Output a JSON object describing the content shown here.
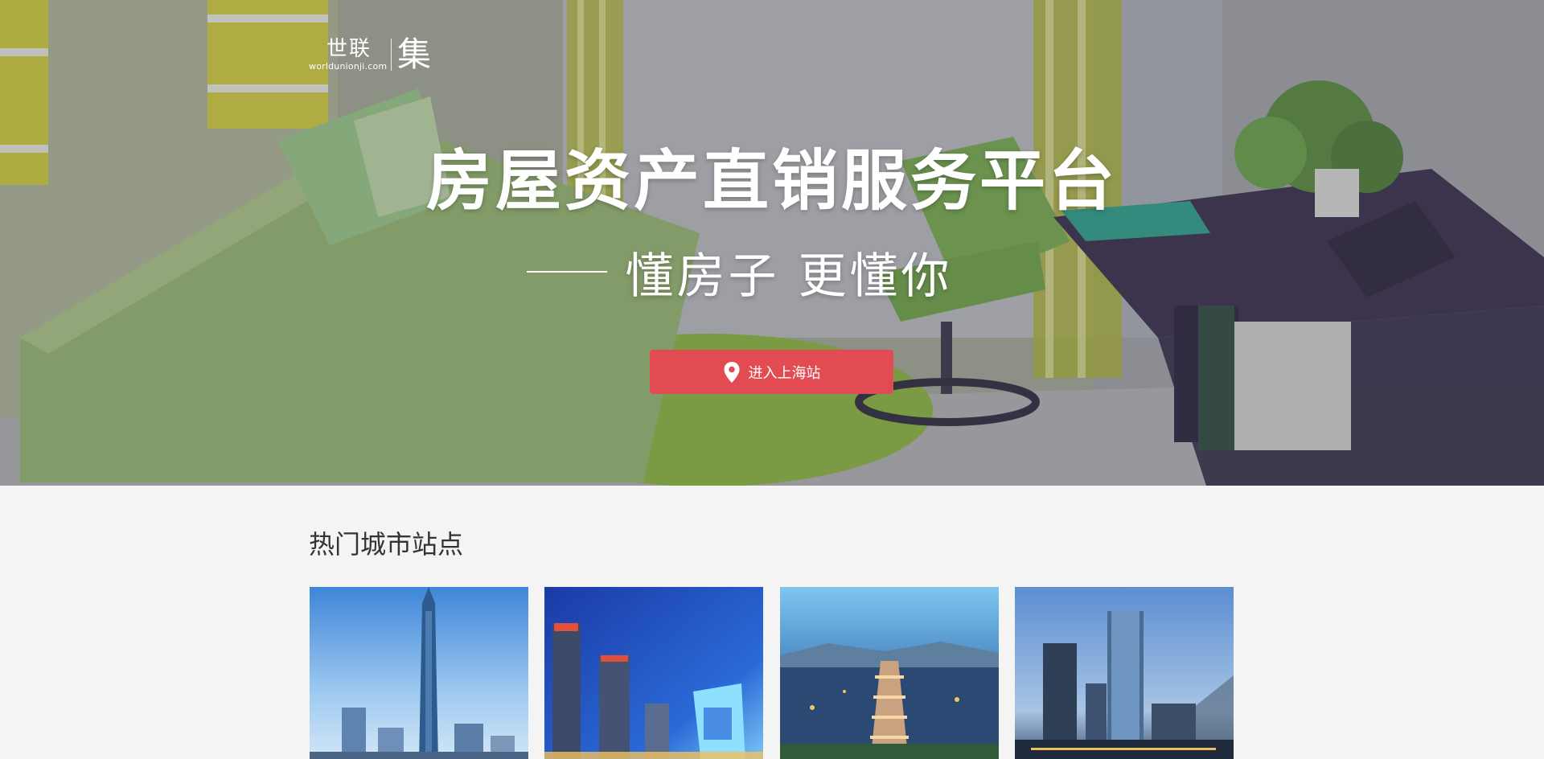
{
  "logo": {
    "cn": "世联",
    "url": "worldunionji.com",
    "ji": "集"
  },
  "hero": {
    "headline": "房屋资产直销服务平台",
    "slogan": "懂房子 更懂你",
    "enter_button": "进入上海站",
    "button_color": "#e34b52"
  },
  "cities": {
    "title": "热门城市站点",
    "items": [
      {
        "icon": "shenzhen-skyline-photo"
      },
      {
        "icon": "beijing-skyline-photo"
      },
      {
        "icon": "xian-pagoda-photo"
      },
      {
        "icon": "city-towers-photo"
      }
    ]
  }
}
